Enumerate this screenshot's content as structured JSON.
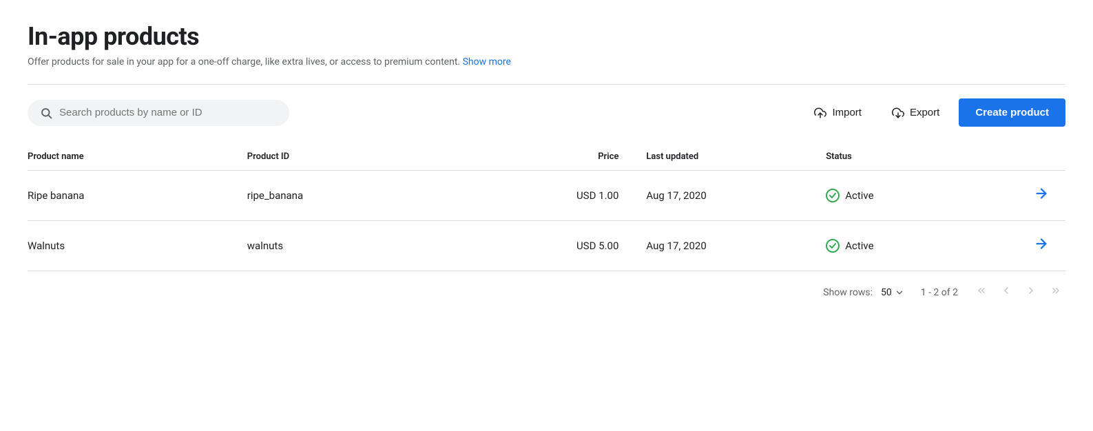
{
  "page": {
    "title": "In-app products",
    "subtitle": "Offer products for sale in your app for a one-off charge, like extra lives, or access to premium content.",
    "show_more_label": "Show more"
  },
  "toolbar": {
    "search_placeholder": "Search products by name or ID",
    "import_label": "Import",
    "export_label": "Export",
    "create_label": "Create product"
  },
  "table": {
    "columns": [
      {
        "key": "name",
        "label": "Product name"
      },
      {
        "key": "id",
        "label": "Product ID"
      },
      {
        "key": "price",
        "label": "Price"
      },
      {
        "key": "updated",
        "label": "Last updated"
      },
      {
        "key": "status",
        "label": "Status"
      }
    ],
    "rows": [
      {
        "name": "Ripe banana",
        "id": "ripe_banana",
        "price": "USD 1.00",
        "updated": "Aug 17, 2020",
        "status": "Active"
      },
      {
        "name": "Walnuts",
        "id": "walnuts",
        "price": "USD 5.00",
        "updated": "Aug 17, 2020",
        "status": "Active"
      }
    ]
  },
  "pagination": {
    "show_rows_label": "Show rows:",
    "rows_per_page": "50",
    "page_info": "1 - 2 of 2"
  },
  "colors": {
    "active_status": "#34a853",
    "arrow_color": "#1a73e8",
    "primary_btn": "#1a73e8"
  }
}
